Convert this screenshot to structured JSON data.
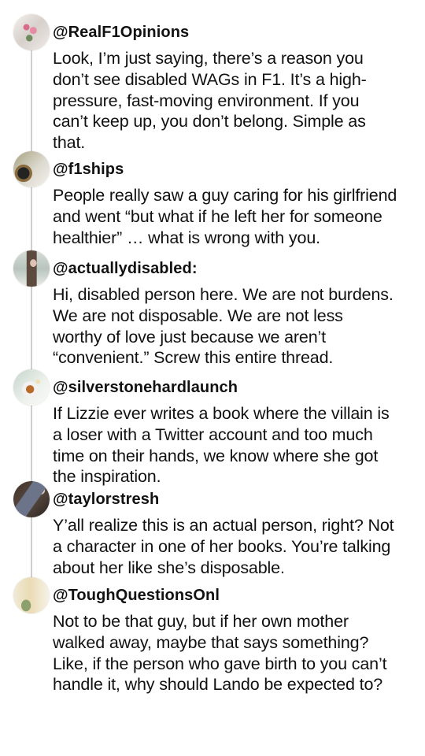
{
  "thread": {
    "posts": [
      {
        "handle": "@RealF1Opinions",
        "avatar": "pink-flowers-avatar",
        "text": "Look, I’m just saying, there’s a reason you\ndon’t see disabled WAGs in F1. It’s a high-\npressure, fast-moving environment. If you\ncan’t keep up, you don’t belong. Simple as\nthat."
      },
      {
        "handle": "@f1ships",
        "avatar": "coffee-avatar",
        "text": "People really saw a guy caring for his girlfriend\nand went “but what if he left her for someone\nhealthier” … what is wrong with you."
      },
      {
        "handle": "@actuallydisabled:",
        "avatar": "portrait-avatar",
        "text": "Hi, disabled person here. We are not burdens.\nWe are not disposable. We are not less\nworthy of love just because we aren’t\n“convenient.” Screw this entire thread."
      },
      {
        "handle": "@silverstonehardlaunch",
        "avatar": "tea-cup-avatar",
        "text": "If Lizzie ever writes a book where the villain is\na loser with a Twitter account and too much\ntime on their hands, we know where she got\nthe inspiration."
      },
      {
        "handle": "@taylorstresh",
        "avatar": "desk-avatar",
        "text": "Y’all realize this is an actual person, right? Not\na character in one of her books. You’re talking\nabout her like she’s disposable."
      },
      {
        "handle": "@ToughQuestionsOnl",
        "avatar": "window-plant-avatar",
        "text": "Not to be that guy, but if her own mother\nwalked away, maybe that says something?\nLike, if the person who gave birth to you can’t\nhandle it, why should Lando be expected to?"
      }
    ]
  }
}
